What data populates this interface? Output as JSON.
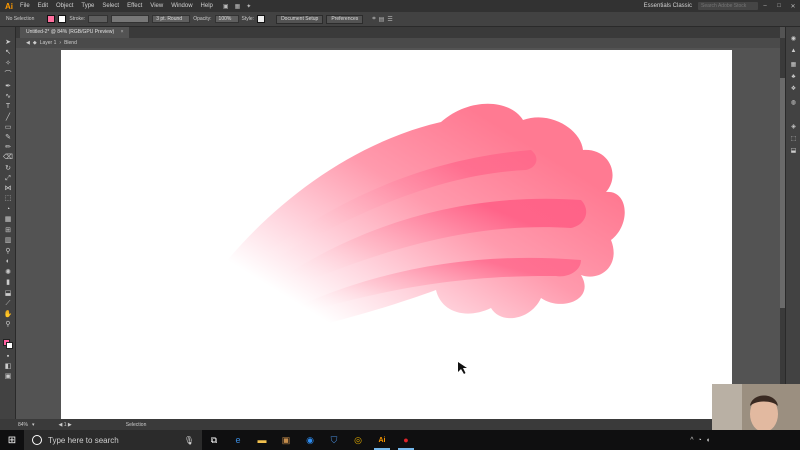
{
  "app": {
    "logo": "Ai",
    "workspace": "Essentials Classic",
    "search_placeholder": "Search Adobe Stock"
  },
  "menu": [
    "File",
    "Edit",
    "Object",
    "Type",
    "Select",
    "Effect",
    "View",
    "Window",
    "Help"
  ],
  "controlbar": {
    "selection": "No Selection",
    "stroke_label": "Stroke:",
    "brush": "3 pt. Round",
    "opacity_label": "Opacity:",
    "opacity_value": "100%",
    "style_label": "Style:",
    "document_setup": "Document Setup",
    "preferences": "Preferences"
  },
  "document": {
    "tab_title": "Untitled-2* @ 84% (RGB/GPU Preview)",
    "close": "×"
  },
  "breadcrumb": {
    "layer": "Layer 1",
    "group": "Blend"
  },
  "status": {
    "zoom": "84%",
    "tool": "Selection"
  },
  "taskbar": {
    "search_placeholder": "Type here to search"
  },
  "colors": {
    "blend_start": "#ff6f8f",
    "blend_end": "#ffffff",
    "accent": "#ff9a00",
    "canvas": "#535353"
  }
}
